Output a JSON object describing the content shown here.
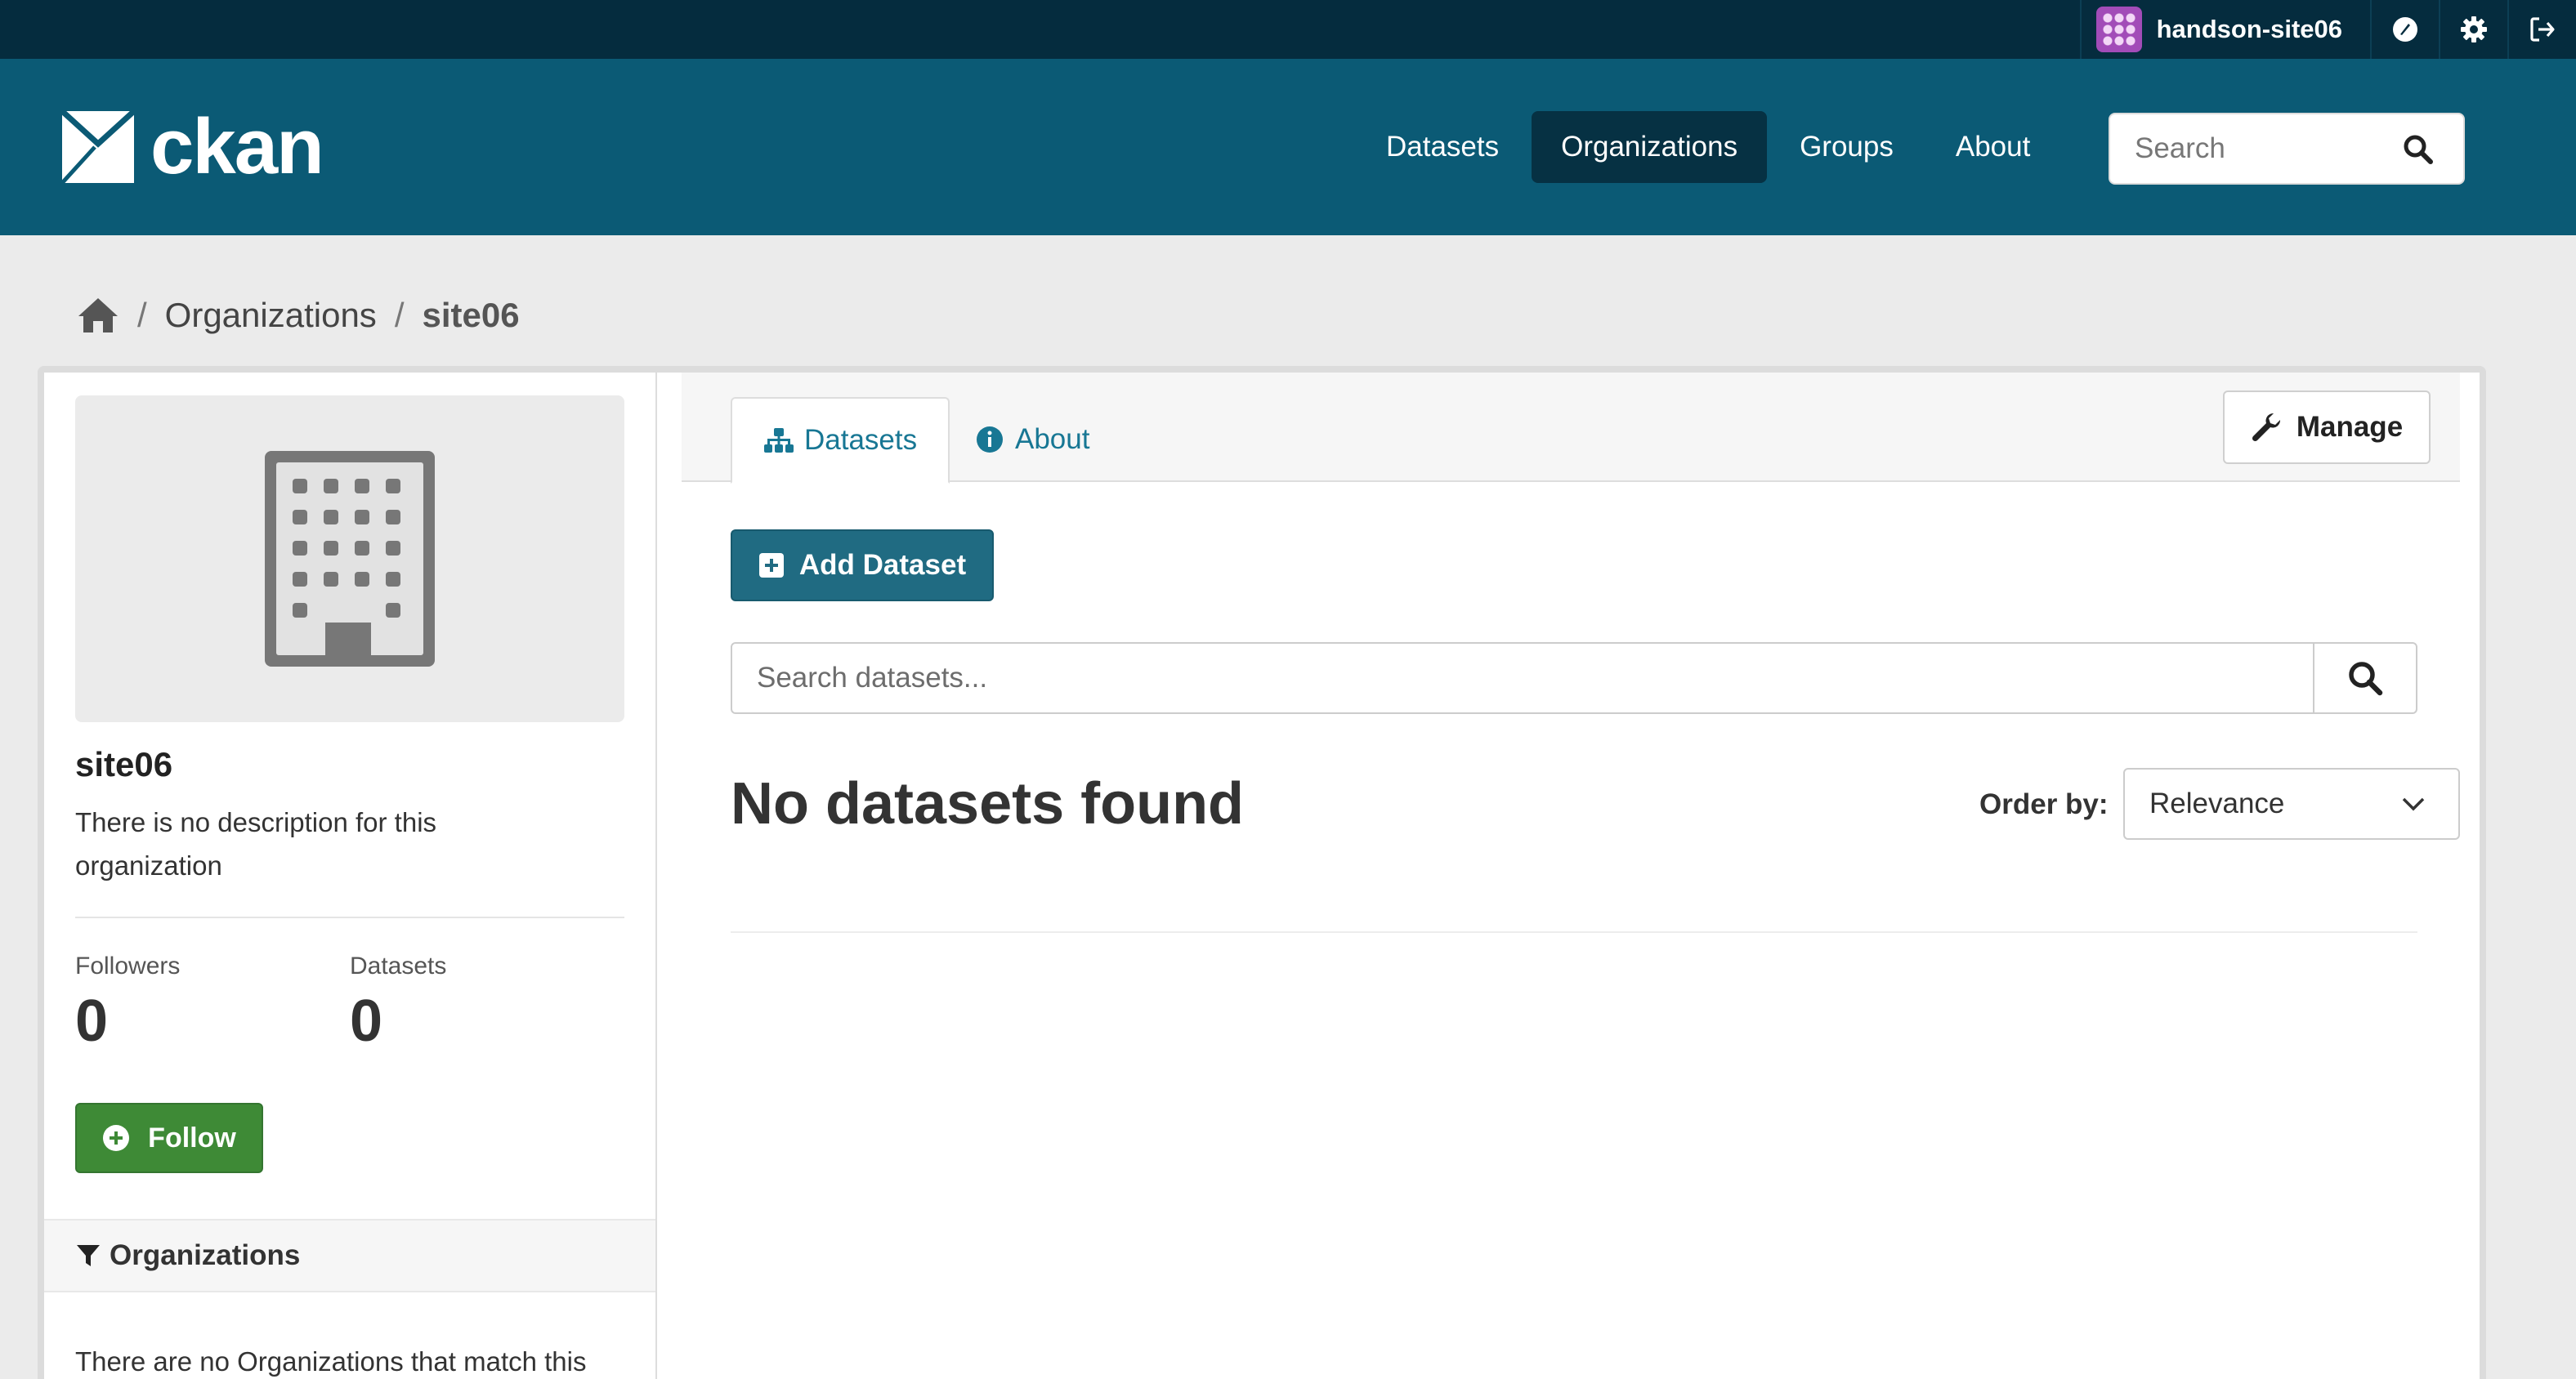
{
  "account": {
    "username": "handson-site06",
    "icons": [
      "dashboard-icon",
      "gear-icon",
      "sign-out-icon"
    ]
  },
  "header": {
    "logo_text": "ckan",
    "nav": [
      {
        "label": "Datasets",
        "active": false
      },
      {
        "label": "Organizations",
        "active": true
      },
      {
        "label": "Groups",
        "active": false
      },
      {
        "label": "About",
        "active": false
      }
    ],
    "search_placeholder": "Search"
  },
  "breadcrumb": {
    "items": [
      "Organizations",
      "site06"
    ]
  },
  "sidebar": {
    "org_name": "site06",
    "description": "There is no description for this organization",
    "followers_label": "Followers",
    "followers_value": "0",
    "datasets_label": "Datasets",
    "datasets_value": "0",
    "follow_label": "Follow",
    "facet_title": "Organizations",
    "facet_empty": "There are no Organizations that match this"
  },
  "main": {
    "tabs": [
      {
        "label": "Datasets",
        "active": true
      },
      {
        "label": "About",
        "active": false
      }
    ],
    "manage_label": "Manage",
    "add_dataset_label": "Add Dataset",
    "search_placeholder": "Search datasets...",
    "no_results": "No datasets found",
    "order_by_label": "Order by:",
    "order_by_value": "Relevance"
  },
  "colors": {
    "account_bar": "#052c3e",
    "masthead": "#0b5a75",
    "nav_active": "#063143",
    "primary_button": "#206b82",
    "follow_button": "#3e8a36",
    "link": "#187794"
  }
}
